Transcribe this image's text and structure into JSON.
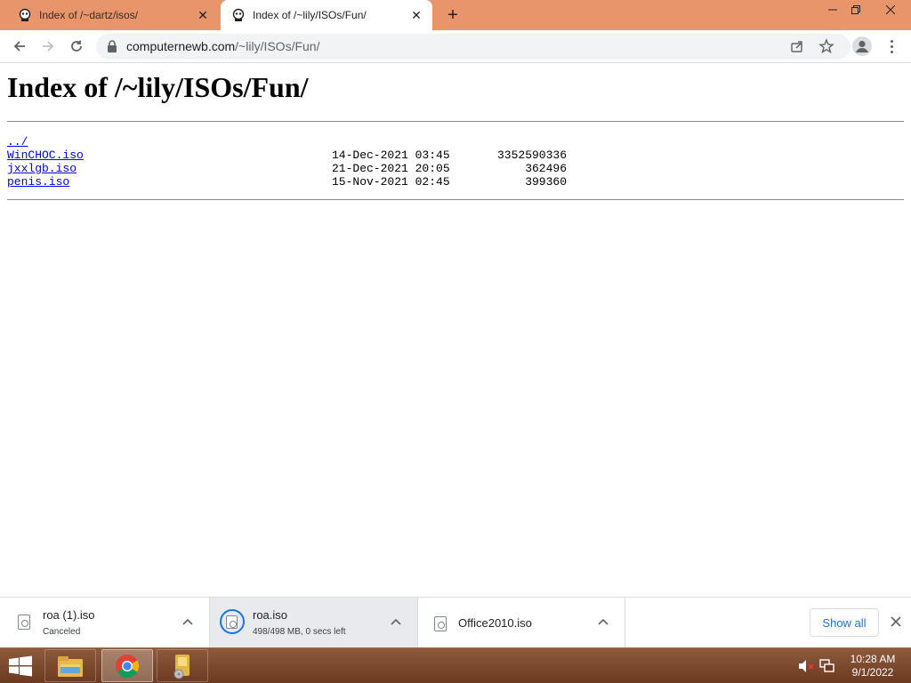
{
  "browser": {
    "tabs": [
      {
        "title": "Index of /~dartz/isos/",
        "active": false
      },
      {
        "title": "Index of /~lily/ISOs/Fun/",
        "active": true
      }
    ],
    "url_host": "computernewb.com",
    "url_path": "/~lily/ISOs/Fun/",
    "accent_color": "#e8956c"
  },
  "page": {
    "heading": "Index of /~lily/ISOs/Fun/",
    "parent_link": "../",
    "entries": [
      {
        "name": "WinCHOC.iso",
        "date": "14-Dec-2021 03:45",
        "size": "3352590336"
      },
      {
        "name": "jxxlgb.iso",
        "date": "21-Dec-2021 20:05",
        "size": "362496"
      },
      {
        "name": "penis.iso",
        "date": "15-Nov-2021 02:45",
        "size": "399360"
      }
    ]
  },
  "downloads": {
    "items": [
      {
        "name": "roa (1).iso",
        "status": "Canceled"
      },
      {
        "name": "roa.iso",
        "status": "498/498 MB, 0 secs left"
      },
      {
        "name": "Office2010.iso",
        "status": ""
      }
    ],
    "show_all_label": "Show all"
  },
  "taskbar": {
    "time": "10:28 AM",
    "date": "9/1/2022",
    "apps": [
      "file-explorer",
      "chrome",
      "other-app"
    ]
  }
}
